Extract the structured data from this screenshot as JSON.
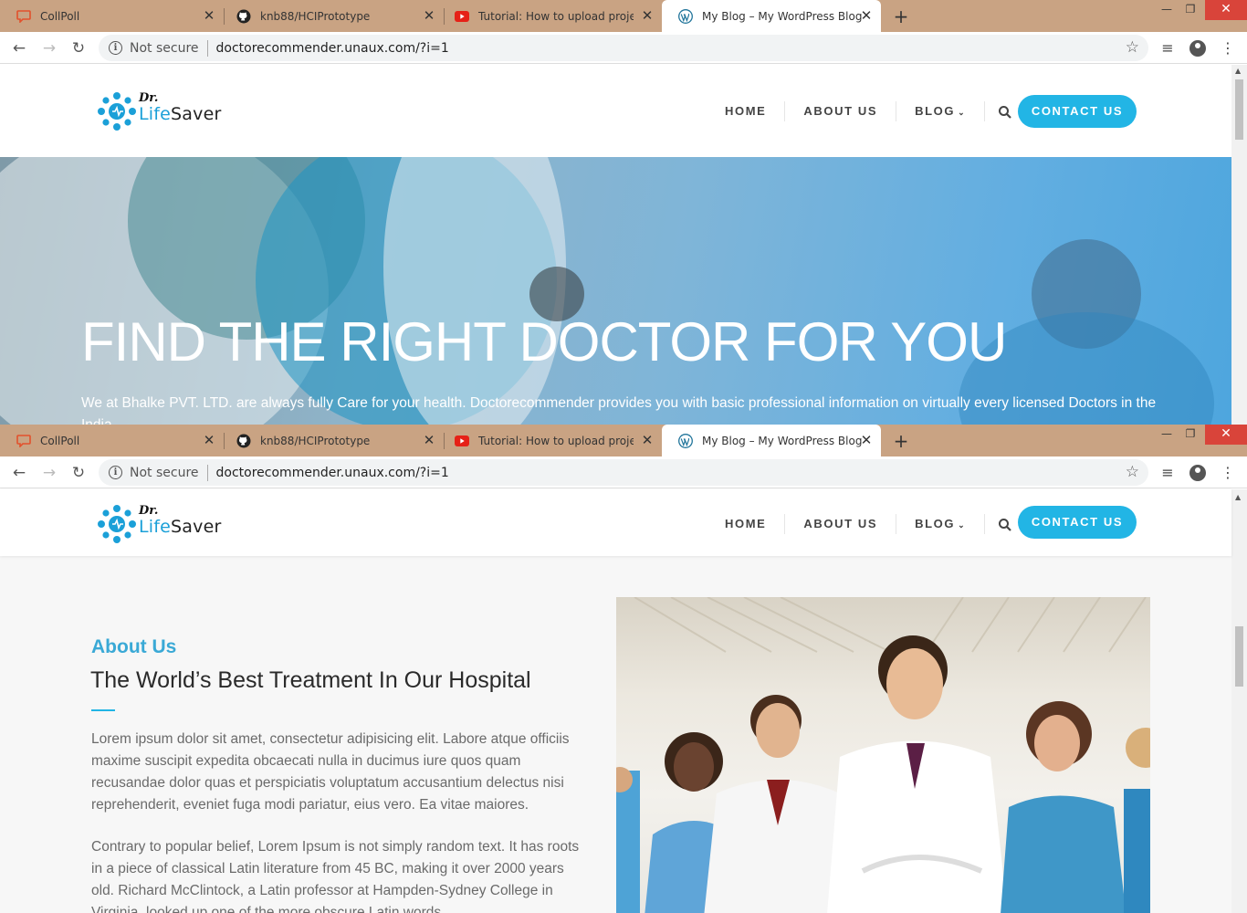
{
  "browser": {
    "tabs": [
      {
        "label": "CollPoll",
        "icon": "collpoll-icon"
      },
      {
        "label": "knb88/HCIPrototype",
        "icon": "github-icon"
      },
      {
        "label": "Tutorial: How to upload project t",
        "icon": "youtube-icon"
      },
      {
        "label": "My Blog – My WordPress Blog",
        "icon": "wordpress-icon"
      }
    ],
    "security_label": "Not secure",
    "url": "doctorecommender.unaux.com/?i=1"
  },
  "site": {
    "logo": {
      "prefix": "Dr.",
      "name_a": "Life",
      "name_b": "Saver"
    },
    "nav": [
      {
        "label": "HOME"
      },
      {
        "label": "ABOUT US"
      },
      {
        "label": "BLOG"
      }
    ],
    "cta_label": "CONTACT US",
    "hero": {
      "title": "FIND THE RIGHT DOCTOR FOR YOU",
      "text": "We at Bhalke PVT. LTD. are always fully Care for your health. Doctorecommender provides you with basic professional information on virtually every licensed Doctors in the India."
    },
    "about": {
      "kicker": "About Us",
      "heading": "The World’s Best Treatment In Our Hospital",
      "para1": "Lorem ipsum dolor sit amet, consectetur adipisicing elit. Labore atque officiis maxime suscipit expedita obcaecati nulla in ducimus iure quos quam recusandae dolor quas et perspiciatis voluptatum accusantium delectus nisi reprehenderit, eveniet fuga modi pariatur, eius vero. Ea vitae maiores.",
      "para2": "Contrary to popular belief, Lorem Ipsum is not simply random text. It has roots in a piece of classical Latin literature from 45 BC, making it over 2000 years old. Richard McClintock, a Latin professor at Hampden-Sydney College in Virginia, looked up one of the more obscure Latin words"
    }
  },
  "colors": {
    "accent": "#22b5e5",
    "tabbar": "#c9a383",
    "close": "#d9443a"
  }
}
